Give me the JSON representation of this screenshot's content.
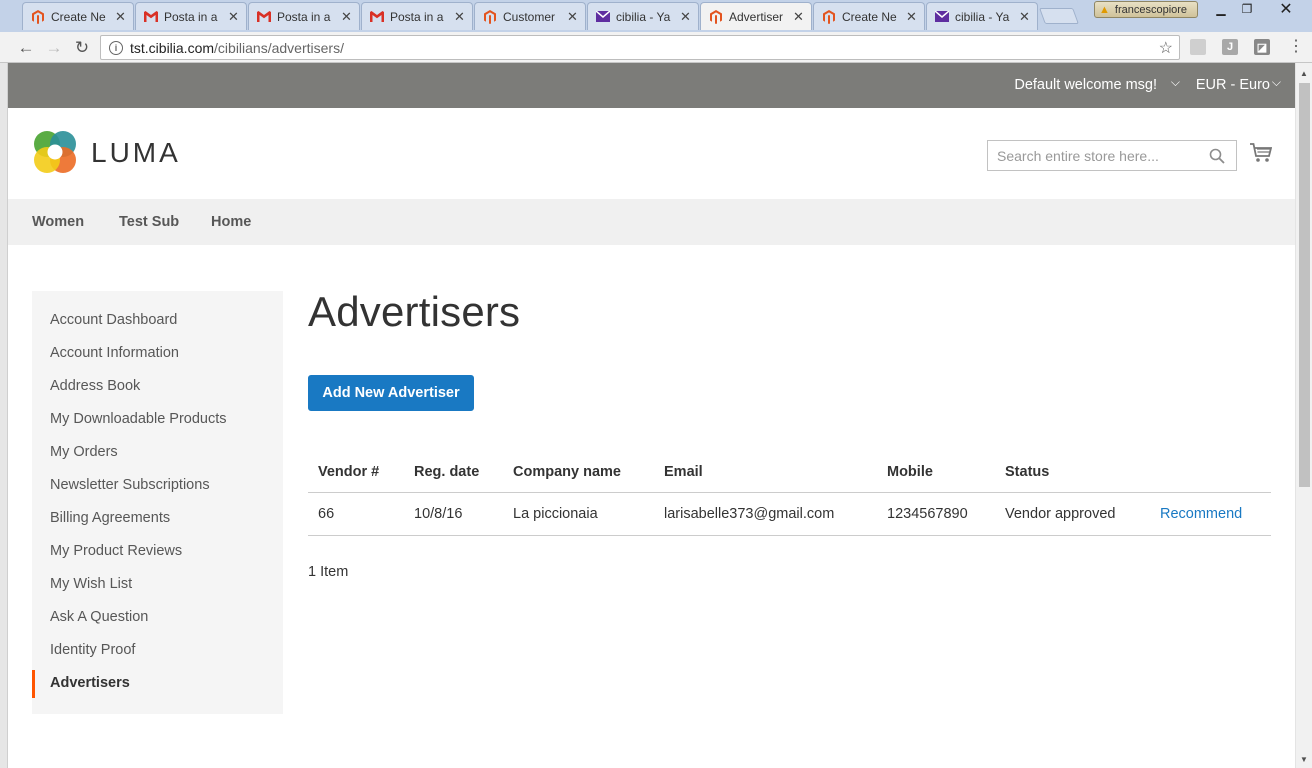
{
  "browser": {
    "tabs": [
      {
        "title": "Create Ne",
        "icon": "magento-icon",
        "active": false
      },
      {
        "title": "Posta in a",
        "icon": "gmail-icon",
        "active": false
      },
      {
        "title": "Posta in a",
        "icon": "gmail-icon",
        "active": false
      },
      {
        "title": "Posta in a",
        "icon": "gmail-icon",
        "active": false
      },
      {
        "title": "Customer",
        "icon": "magento-icon",
        "active": false
      },
      {
        "title": "cibilia - Ya",
        "icon": "yahoo-mail-icon",
        "active": false
      },
      {
        "title": "Advertiser",
        "icon": "magento-icon",
        "active": true
      },
      {
        "title": "Create Ne",
        "icon": "magento-icon",
        "active": false
      },
      {
        "title": "cibilia - Ya",
        "icon": "yahoo-mail-icon",
        "active": false
      }
    ],
    "profile_name": "francescopiore",
    "url_host": "tst.cibilia.com",
    "url_path": "/cibilians/advertisers/",
    "colors": {
      "magento": "#e3541f",
      "gmail": "#d93025",
      "yahoo": "#5f2ea0"
    }
  },
  "header": {
    "welcome": "Default welcome msg!",
    "currency": "EUR - Euro",
    "brand": "LUMA",
    "search_placeholder": "Search entire store here..."
  },
  "nav": {
    "items": [
      "Women",
      "Test Sub",
      "Home"
    ]
  },
  "sidebar": {
    "items": [
      "Account Dashboard",
      "Account Information",
      "Address Book",
      "My Downloadable Products",
      "My Orders",
      "Newsletter Subscriptions",
      "Billing Agreements",
      "My Product Reviews",
      "My Wish List",
      "Ask A Question",
      "Identity Proof",
      "Advertisers"
    ],
    "current": "Advertisers"
  },
  "main": {
    "title": "Advertisers",
    "add_button": "Add New Advertiser",
    "table": {
      "headers": [
        "Vendor #",
        "Reg. date",
        "Company name",
        "Email",
        "Mobile",
        "Status"
      ],
      "rows": [
        {
          "vendor": "66",
          "reg_date": "10/8/16",
          "company": "La piccionaia",
          "email": "larisabelle373@gmail.com",
          "mobile": "1234567890",
          "status": "Vendor approved",
          "action": "Recommend"
        }
      ]
    },
    "count": "1 Item"
  },
  "accent_colors": {
    "primary": "#1979c3",
    "sidebar_active": "#ff5501",
    "panel": "#7c7c79"
  }
}
